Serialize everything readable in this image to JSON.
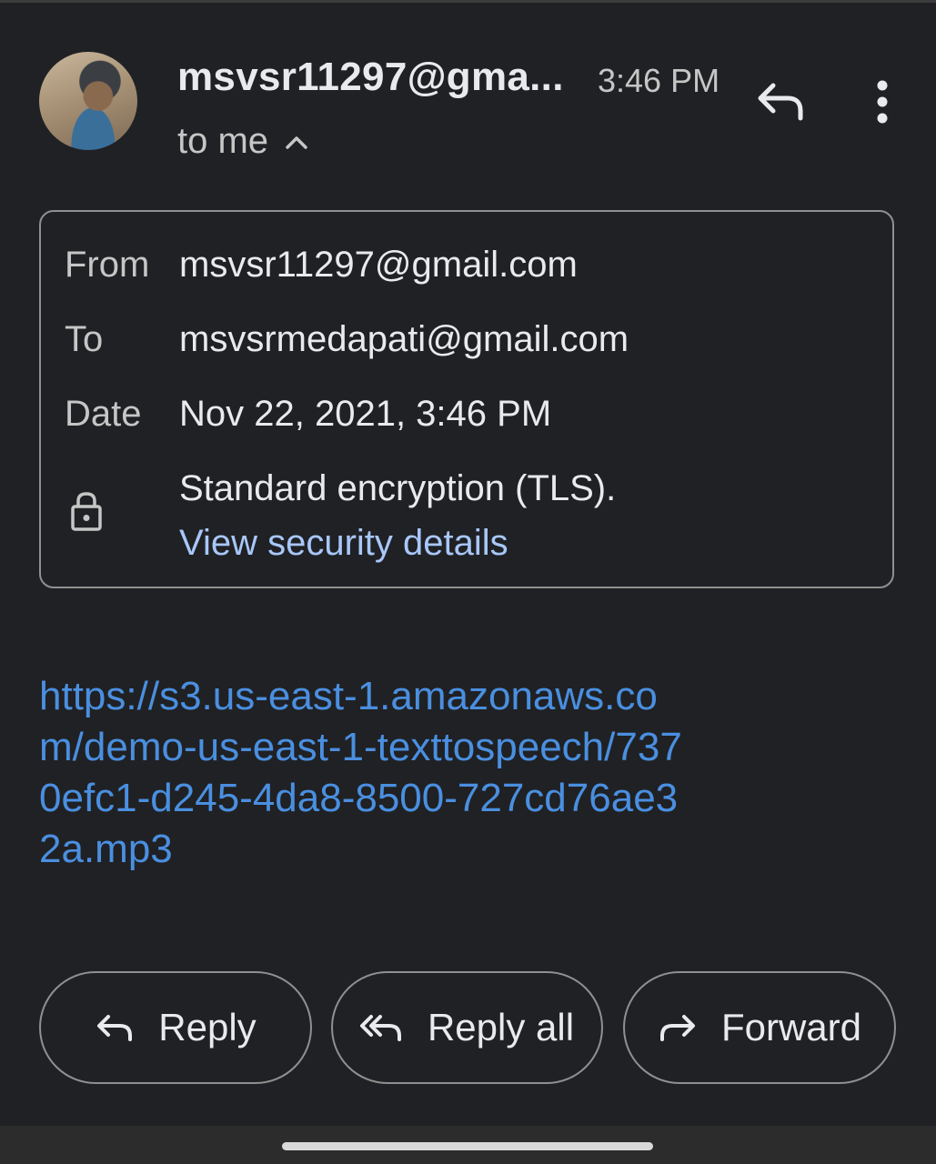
{
  "header": {
    "sender": "msvsr11297@gma...",
    "time": "3:46 PM",
    "recipient_summary": "to me"
  },
  "details": {
    "from_label": "From",
    "from_value": "msvsr11297@gmail.com",
    "to_label": "To",
    "to_value": "msvsrmedapati@gmail.com",
    "date_label": "Date",
    "date_value": "Nov 22, 2021, 3:46 PM",
    "encryption_text": "Standard encryption (TLS).",
    "security_link": "View security details"
  },
  "body": {
    "link_text": "https://s3.us-east-1.amazonaws.com/demo-us-east-1-texttospeech/7370efc1-d245-4da8-8500-727cd76ae32a.mp3"
  },
  "actions": {
    "reply": "Reply",
    "reply_all": "Reply all",
    "forward": "Forward"
  },
  "icons": {
    "reply_top": "reply-icon",
    "more": "more-vert-icon",
    "expand": "chevron-up-icon",
    "lock": "lock-icon",
    "reply": "reply-icon",
    "reply_all": "reply-all-icon",
    "forward": "forward-icon"
  },
  "colors": {
    "background": "#202124",
    "link": "#4a8fe0",
    "security_link": "#a8c7fa"
  }
}
